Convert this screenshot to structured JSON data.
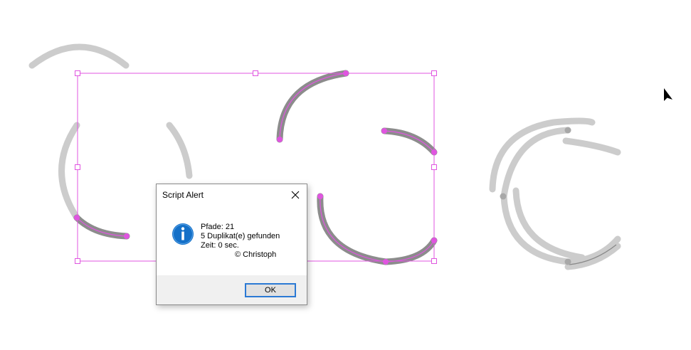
{
  "dialog": {
    "title": "Script Alert",
    "close_icon": "close-icon",
    "info_icon": "info-icon",
    "lines": [
      "Pfade: 21",
      "5 Duplikat(e) gefunden",
      "Zeit: 0 sec."
    ],
    "copyright": "©  Christoph",
    "ok_label": "OK"
  },
  "colors": {
    "path_gray": "#cccccc",
    "selection_magenta": "#e055e0",
    "selected_stroke": "#8c8c8c",
    "accent_blue": "#2b79d4",
    "info_blue": "#1470c8"
  }
}
